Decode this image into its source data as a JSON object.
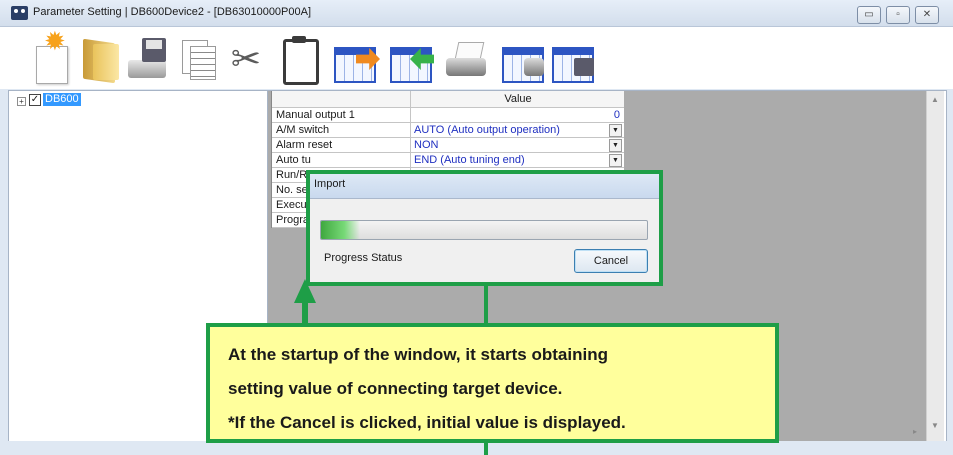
{
  "window": {
    "title": "Parameter Setting  | DB600Device2 - [DB63010000P00A]",
    "controls": {
      "minimize": "▭",
      "maximize": "▫",
      "close": "✕"
    }
  },
  "toolbar": {
    "buttons": [
      {
        "name": "new",
        "icon": "new-document-icon"
      },
      {
        "name": "open",
        "icon": "folder-icon"
      },
      {
        "name": "save",
        "icon": "save-to-drive-icon"
      },
      {
        "name": "copy",
        "icon": "copy-icon"
      },
      {
        "name": "cut",
        "icon": "scissors-icon"
      },
      {
        "name": "paste",
        "icon": "clipboard-icon"
      },
      {
        "name": "export",
        "icon": "export-table-icon"
      },
      {
        "name": "import",
        "icon": "import-table-icon"
      },
      {
        "name": "print",
        "icon": "printer-icon"
      },
      {
        "name": "print-table",
        "icon": "print-table-icon"
      },
      {
        "name": "save-table",
        "icon": "save-table-icon"
      }
    ],
    "cut_glyph": "✂"
  },
  "tree": {
    "expander": "+",
    "checkbox": "✓",
    "root_label": "DB600"
  },
  "grid": {
    "header_value": "Value",
    "rows": [
      {
        "name": "Manual output 1",
        "value": "0"
      },
      {
        "name": "A/M switch",
        "value": "AUTO (Auto output operation)"
      },
      {
        "name": "Alarm reset",
        "value": "NON"
      },
      {
        "name": "Auto tu",
        "value": "END (Auto tuning end)"
      },
      {
        "name": "Run/R",
        "value": ""
      },
      {
        "name": "No. se",
        "value": ""
      },
      {
        "name": "Execu",
        "value": ""
      },
      {
        "name": "Progra",
        "value": ""
      }
    ],
    "dropdown_glyph": "▼"
  },
  "dialog": {
    "title": "Import",
    "progress_fraction": 0.12,
    "status_label": "Progress Status",
    "cancel_label": "Cancel"
  },
  "callout": {
    "line1": "At the startup of the window, it starts obtaining",
    "line2": "setting value of connecting target device.",
    "line3": "*If the Cancel is clicked, initial value is displayed."
  },
  "scroll": {
    "up": "▲",
    "down": "▼",
    "right": "▸"
  },
  "colors": {
    "accent_green": "#1e9e47",
    "callout_bg": "#ffff9c",
    "value_text": "#1f2fc0",
    "selection": "#3399ff"
  }
}
